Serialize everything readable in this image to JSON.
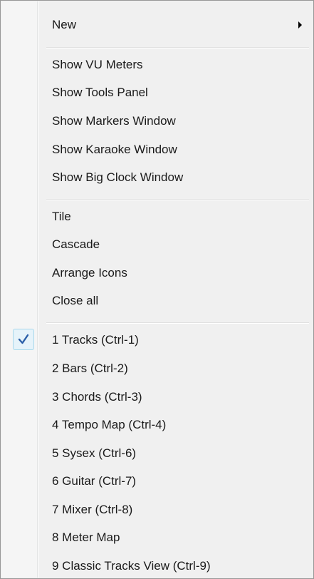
{
  "menu": {
    "new_label": "New",
    "view_items": [
      "Show VU Meters",
      "Show Tools Panel",
      "Show Markers Window",
      "Show Karaoke Window",
      "Show Big Clock Window"
    ],
    "arrange_items": [
      "Tile",
      "Cascade",
      "Arrange Icons",
      "Close all"
    ],
    "window_items": [
      "1 Tracks (Ctrl-1)",
      "2 Bars (Ctrl-2)",
      "3 Chords (Ctrl-3)",
      "4 Tempo Map (Ctrl-4)",
      "5 Sysex (Ctrl-6)",
      "6 Guitar (Ctrl-7)",
      "7 Mixer (Ctrl-8)",
      "8 Meter Map",
      "9 Classic Tracks View (Ctrl-9)"
    ],
    "checked_window_index": 0,
    "icons": {
      "check": "checkmark-icon",
      "submenu": "submenu-arrow-icon"
    },
    "colors": {
      "check": "#2a5ea8",
      "check_highlight": "#e6f3fa"
    }
  }
}
